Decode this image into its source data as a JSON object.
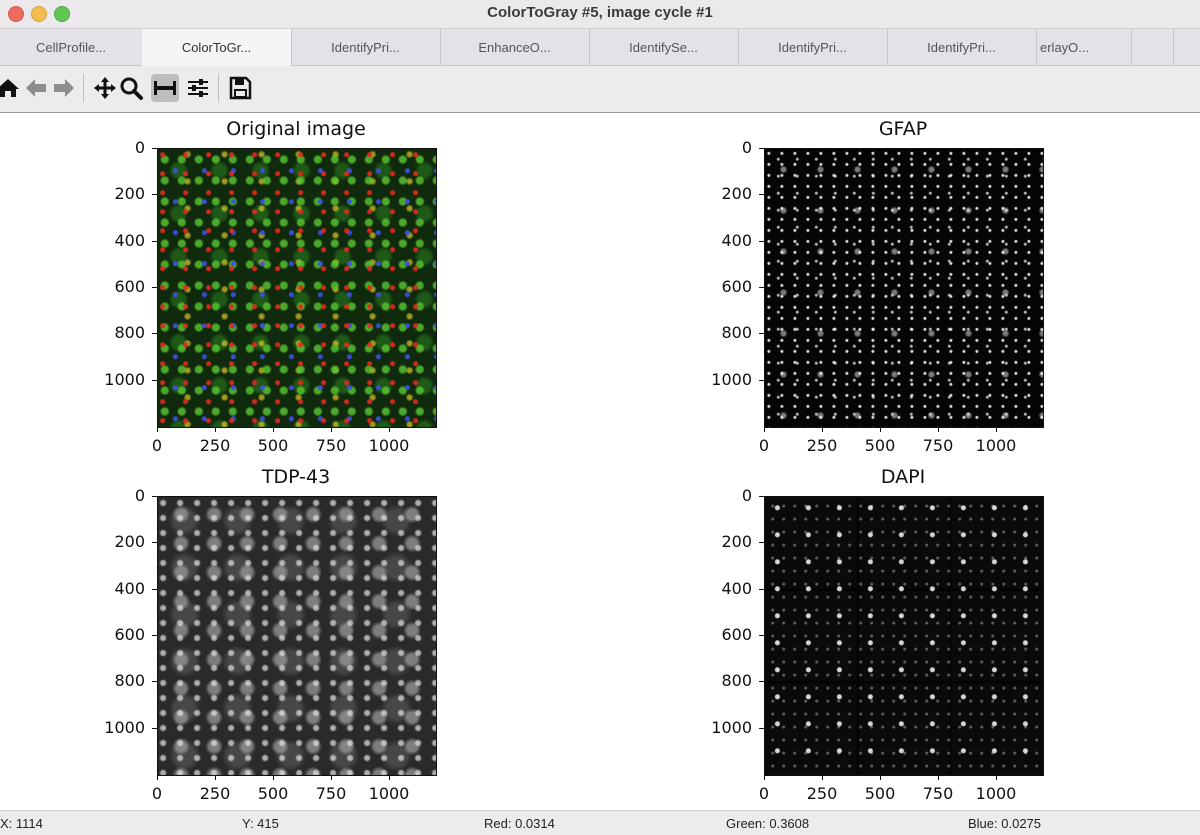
{
  "window": {
    "title": "ColorToGray #5, image cycle #1"
  },
  "tabs": [
    {
      "label": "CellProfile..."
    },
    {
      "label": "ColorToGr..."
    },
    {
      "label": "IdentifyPri..."
    },
    {
      "label": "EnhanceO..."
    },
    {
      "label": "IdentifySe..."
    },
    {
      "label": "IdentifyPri..."
    },
    {
      "label": "IdentifyPri..."
    },
    {
      "label": "erlayO..."
    },
    {
      "label": ""
    },
    {
      "label": ""
    }
  ],
  "toolbar": {
    "buttons": [
      {
        "icon": "home-icon"
      },
      {
        "icon": "back-arrow-icon"
      },
      {
        "icon": "forward-arrow-icon"
      },
      {
        "icon": "pan-icon"
      },
      {
        "icon": "zoom-icon"
      },
      {
        "icon": "subplots-icon"
      },
      {
        "icon": "sliders-icon"
      },
      {
        "icon": "save-icon"
      }
    ]
  },
  "panels": [
    {
      "title": "Original image",
      "yticks": [
        "0",
        "200",
        "400",
        "600",
        "800",
        "1000"
      ],
      "xticks": [
        "0",
        "250",
        "500",
        "750",
        "1000"
      ]
    },
    {
      "title": "GFAP",
      "yticks": [
        "0",
        "200",
        "400",
        "600",
        "800",
        "1000"
      ],
      "xticks": [
        "0",
        "250",
        "500",
        "750",
        "1000"
      ]
    },
    {
      "title": "TDP-43",
      "yticks": [
        "0",
        "200",
        "400",
        "600",
        "800",
        "1000"
      ],
      "xticks": [
        "0",
        "250",
        "500",
        "750",
        "1000"
      ]
    },
    {
      "title": "DAPI",
      "yticks": [
        "0",
        "200",
        "400",
        "600",
        "800",
        "1000"
      ],
      "xticks": [
        "0",
        "250",
        "500",
        "750",
        "1000"
      ]
    }
  ],
  "status": {
    "x": "X: 1114",
    "y": "Y: 415",
    "red": "Red: 0.0314",
    "green": "Green: 0.3608",
    "blue": "Blue: 0.0275"
  }
}
